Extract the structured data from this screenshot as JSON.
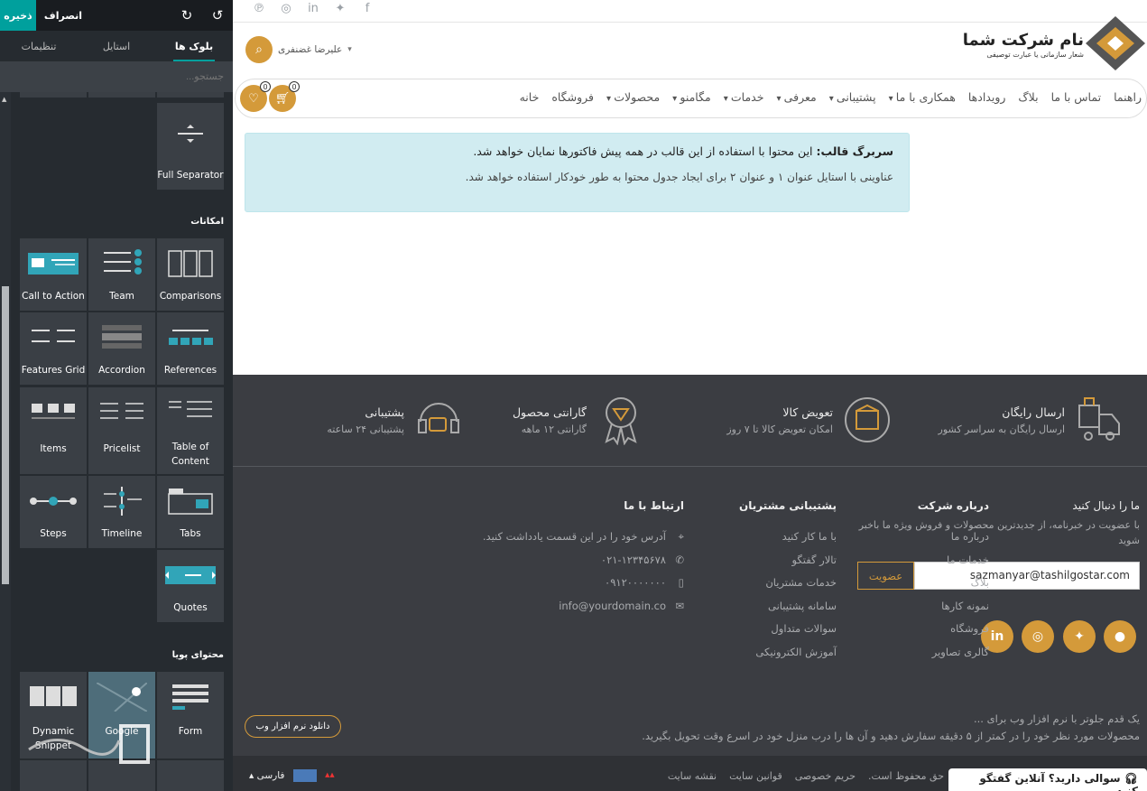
{
  "toolbar": {
    "save": "ذخیره",
    "discard": "انصراف"
  },
  "tabs": {
    "blocks": "بلوک ها",
    "style": "استایل",
    "settings": "تنظیمات"
  },
  "search": {
    "placeholder": "جستجو..."
  },
  "sections": {
    "features": "امکانات",
    "dynamic": "محتوای پویا"
  },
  "tiles": {
    "full_separator": "Full Separator",
    "call_to_action": "Call to Action",
    "team": "Team",
    "comparisons": "Comparisons",
    "features_grid": "Features Grid",
    "accordion": "Accordion",
    "references": "References",
    "items": "Items",
    "pricelist": "Pricelist",
    "table_of_content": "Table of Content",
    "steps": "Steps",
    "timeline": "Timeline",
    "tabs": "Tabs",
    "quotes": "Quotes",
    "dynamic_snippet": "Dynamic Snippet",
    "google": "Google",
    "form": "Form"
  },
  "header": {
    "brand_name": "نام شرکت شما",
    "brand_slogan": "شعار سازمانی یا عبارت توصیفی",
    "user_name": "علیرضا غضنفری",
    "cart_count": "0",
    "wish_count": "0",
    "nav": [
      "خانه",
      "فروشگاه",
      "محصولات",
      "مگامنو",
      "خدمات",
      "معرفی",
      "پشتیبانی",
      "همکاری با ما",
      "رویدادها",
      "بلاگ",
      "تماس با ما",
      "راهنما"
    ],
    "nav_dropdown": [
      false,
      false,
      true,
      true,
      true,
      true,
      true,
      true,
      false,
      false,
      false,
      false
    ]
  },
  "alert": {
    "title": "سربرگ قالب:",
    "line1": " این محتوا با استفاده از این قالب در همه پیش فاکتورها نمایان خواهد شد.",
    "line2": "عناوینی با استایل عنوان ۱ و عنوان ۲ برای ایجاد جدول محتوا به طور خودکار استفاده خواهد شد."
  },
  "features": [
    {
      "title": "ارسال رایگان",
      "sub": "ارسال رایگان به سراسر کشور",
      "icon": "truck-icon"
    },
    {
      "title": "تعویض کالا",
      "sub": "امکان تعویض کالا تا ۷ روز",
      "icon": "box-return-icon"
    },
    {
      "title": "گارانتی محصول",
      "sub": "گارانتی ۱۲ ماهه",
      "icon": "diamond-badge-icon"
    },
    {
      "title": "پشتیبانی",
      "sub": "پشتیبانی ۲۴ ساعته",
      "icon": "headset-icon"
    }
  ],
  "follow": {
    "title": "ما را دنبال کنید",
    "text": "با عضویت در خبرنامه، از جدیدترین محصولات و فروش ویژه ما باخبر شوید",
    "email": "sazmanyar@tashilgostar.com",
    "subscribe": "عضویت"
  },
  "about": {
    "title": "درباره شرکت",
    "links": [
      "درباره ما",
      "خدمات ما",
      "بلاگ",
      "نمونه کارها",
      "فروشگاه",
      "گالری تصاویر"
    ]
  },
  "support": {
    "title": "پشتیبانی مشتریان",
    "links": [
      "با ما کار کنید",
      "تالار گفتگو",
      "خدمات مشتریان",
      "سامانه پشتیبانی",
      "سوالات متداول",
      "آموزش الکترونیکی"
    ]
  },
  "contact": {
    "title": "ارتباط با ما",
    "address": "آدرس خود را در این قسمت یادداشت کنید.",
    "phone": "۰۲۱-۱۲۳۴۵۶۷۸",
    "mobile": "۰۹۱۲۰۰۰۰۰۰۰",
    "email": "info@yourdomain.co"
  },
  "promo": {
    "line1": "یک قدم جلوتر با نرم افزار وب برای ...",
    "line2": "محصولات مورد نظر خود را در کمتر از ۵ دقیقه سفارش دهید و آن ها را درب منزل خود در اسرع وقت تحویل بگیرید.",
    "button": "دانلود نرم افزار وب"
  },
  "bottom": {
    "links": [
      "حق محفوظ است.",
      "حریم خصوصی",
      "قوانین سایت",
      "نقشه سایت"
    ],
    "language": "فارسی",
    "chat": "سوالی دارید؟ آنلاین گفتگو کنید."
  },
  "colors": {
    "accent": "#d49a3a",
    "editor_teal": "#00a09d",
    "footer_bg": "#3b3d42",
    "alert_bg": "#d1ecf1"
  }
}
